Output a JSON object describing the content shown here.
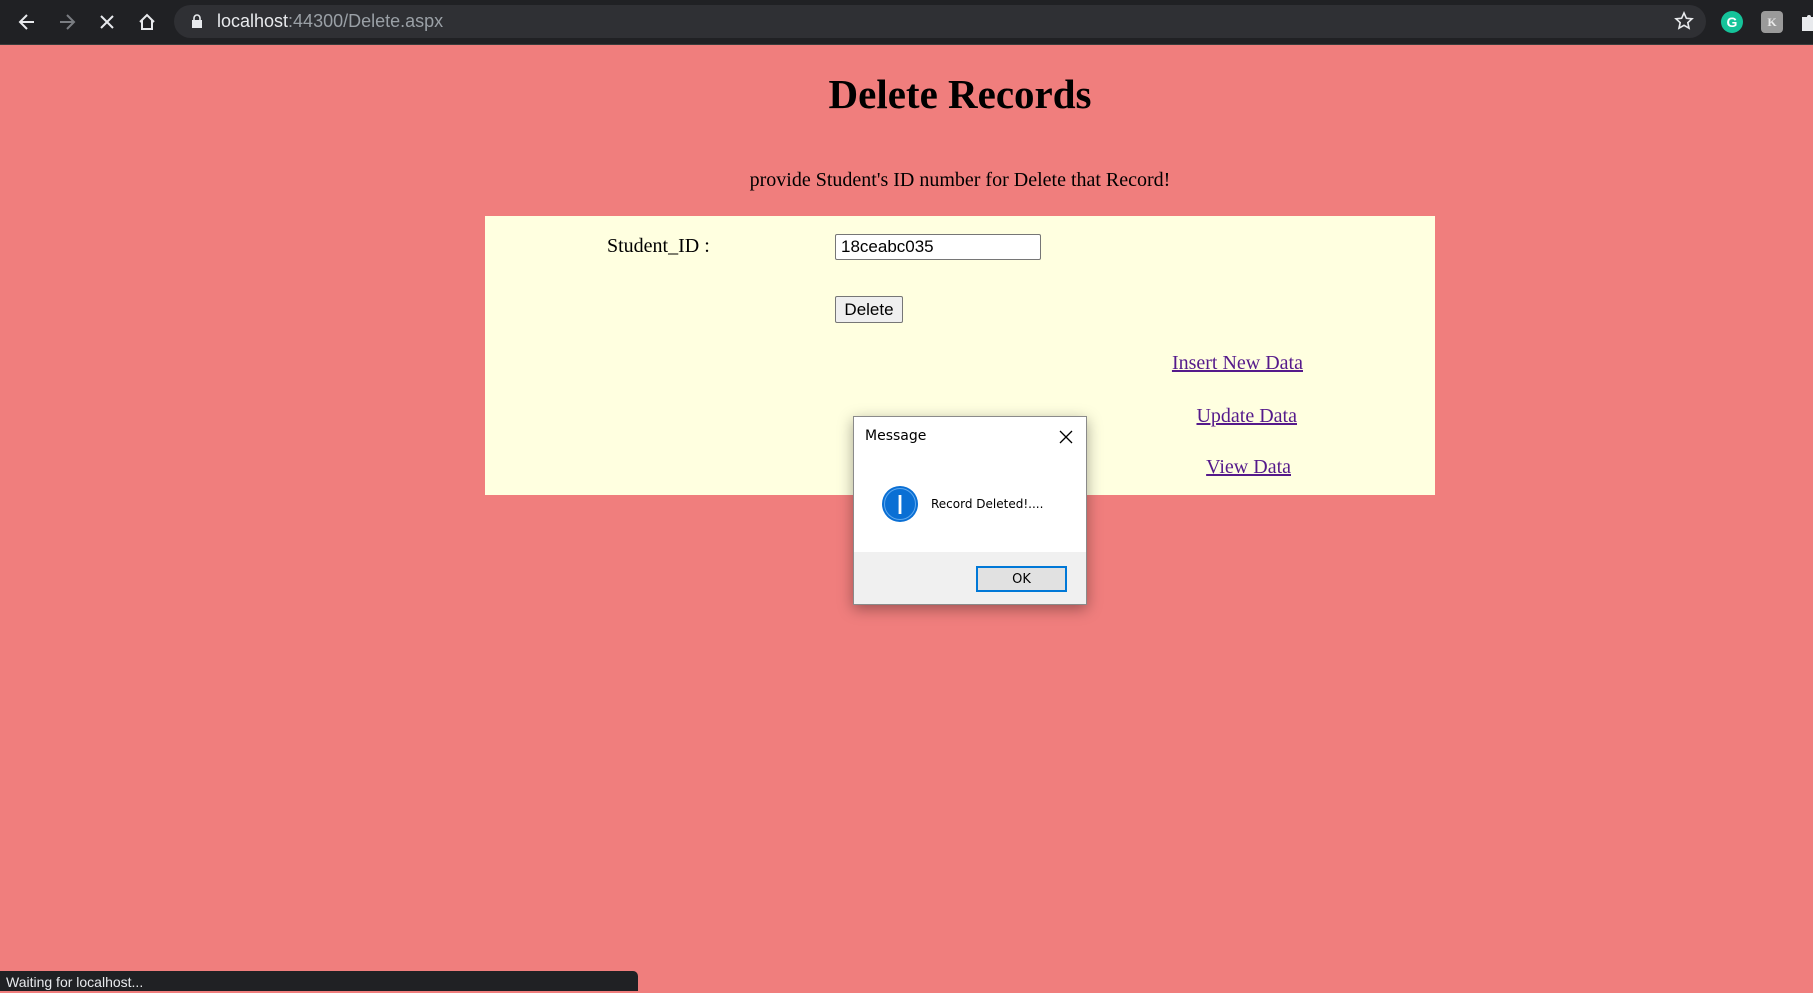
{
  "browser": {
    "url_host": "localhost",
    "url_path": ":44300/Delete.aspx",
    "extensions": {
      "grammarly_letter": "G",
      "second_letter": "K"
    },
    "status_text": "Waiting for localhost..."
  },
  "page": {
    "title": "Delete Records",
    "instruction": "provide Student's ID number for Delete that Record!",
    "field_label": "Student_ID :",
    "student_id_value": "18ceabc035",
    "delete_label": "Delete",
    "links": {
      "insert": "Insert New Data",
      "update": "Update Data",
      "view": "View Data"
    }
  },
  "dialog": {
    "title": "Message",
    "message": "Record Deleted!....",
    "ok_label": "OK"
  },
  "colors": {
    "page_background": "#f07e7d",
    "panel_background": "#ffffe0",
    "link": "#551a8b",
    "accent": "#0078d7"
  }
}
